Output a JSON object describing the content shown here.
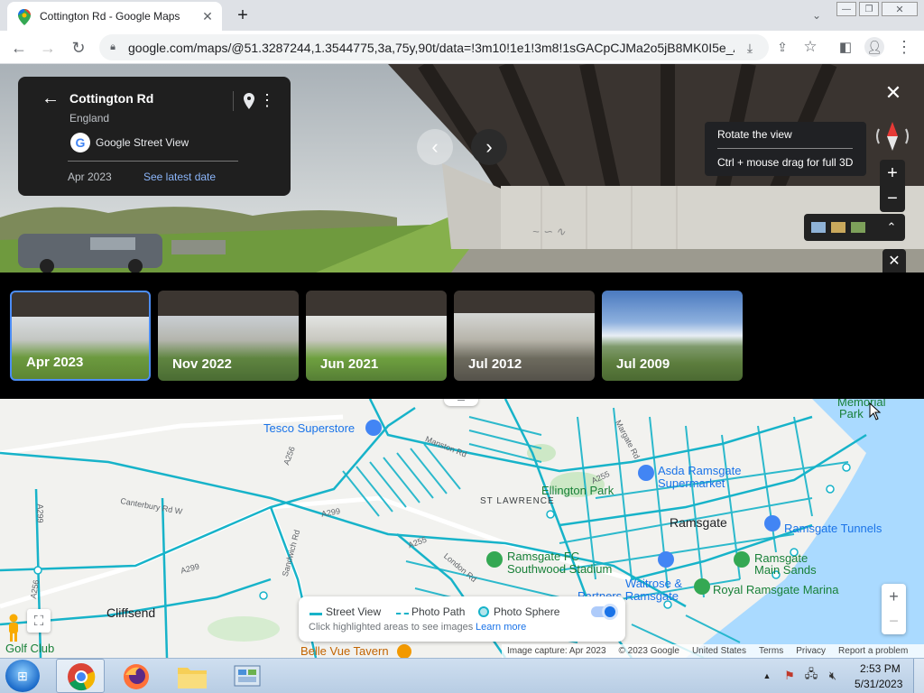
{
  "browser": {
    "tab_title": "Cottington Rd - Google Maps",
    "url": "google.com/maps/@51.3287244,1.3544775,3a,75y,90t/data=!3m10!1e1!3m8!1sGACpCJMa2o5jB8MK0I5e_A..."
  },
  "infocard": {
    "title": "Cottington Rd",
    "subtitle": "England",
    "source": "Google Street View",
    "date": "Apr 2023",
    "latest_link": "See latest date"
  },
  "tooltip": {
    "line1": "Rotate the view",
    "line2": "Ctrl + mouse drag for full 3D"
  },
  "timeline": [
    {
      "label": "Apr 2023"
    },
    {
      "label": "Nov 2022"
    },
    {
      "label": "Jun 2021"
    },
    {
      "label": "Jul 2012"
    },
    {
      "label": "Jul 2009"
    }
  ],
  "map": {
    "labels": {
      "tesco": "Tesco Superstore",
      "asda1": "Asda Ramsgate",
      "asda2": "Supermarket",
      "ellington": "Ellington Park",
      "st_lawrence": "ST LAWRENCE",
      "ramsgate": "Ramsgate",
      "tunnels": "Ramsgate Tunnels",
      "fc1": "Ramsgate FC",
      "fc2": "Southwood Stadium",
      "sands1": "Ramsgate",
      "sands2": "Main Sands",
      "waitrose1": "Waitrose &",
      "waitrose2": "Partners Ramsgate",
      "marina": "Royal Ramsgate Marina",
      "cliffsend": "Cliffsend",
      "golf": "Golf Club",
      "bellevue": "Belle Vue Tavern",
      "memorial1": "Memorial",
      "memorial2": "Park",
      "manston": "Manston Rd",
      "margate": "Margate Rd",
      "canterbury": "Canterbury Rd W",
      "a299a": "A299",
      "a299b": "A299",
      "a299c": "A299",
      "a256a": "A256",
      "a256b": "A256",
      "a255a": "A255",
      "a255b": "A255",
      "sandwich": "Sandwich Rd",
      "london": "London Rd"
    }
  },
  "legend": {
    "street_view": "Street View",
    "photo_path": "Photo Path",
    "photo_sphere": "Photo Sphere",
    "hint": "Click highlighted areas to see images",
    "learn_more": "Learn more"
  },
  "footer": {
    "capture": "Image capture: Apr 2023",
    "copyright": "© 2023 Google",
    "country": "United States",
    "terms": "Terms",
    "privacy": "Privacy",
    "report": "Report a problem"
  },
  "taskbar": {
    "time": "2:53 PM",
    "date": "5/31/2023"
  },
  "colors": {
    "sv_line": "#17b3c9",
    "link": "#8ab4f8",
    "selected_border": "#4c8df6",
    "toggle": "#1a73e8"
  }
}
